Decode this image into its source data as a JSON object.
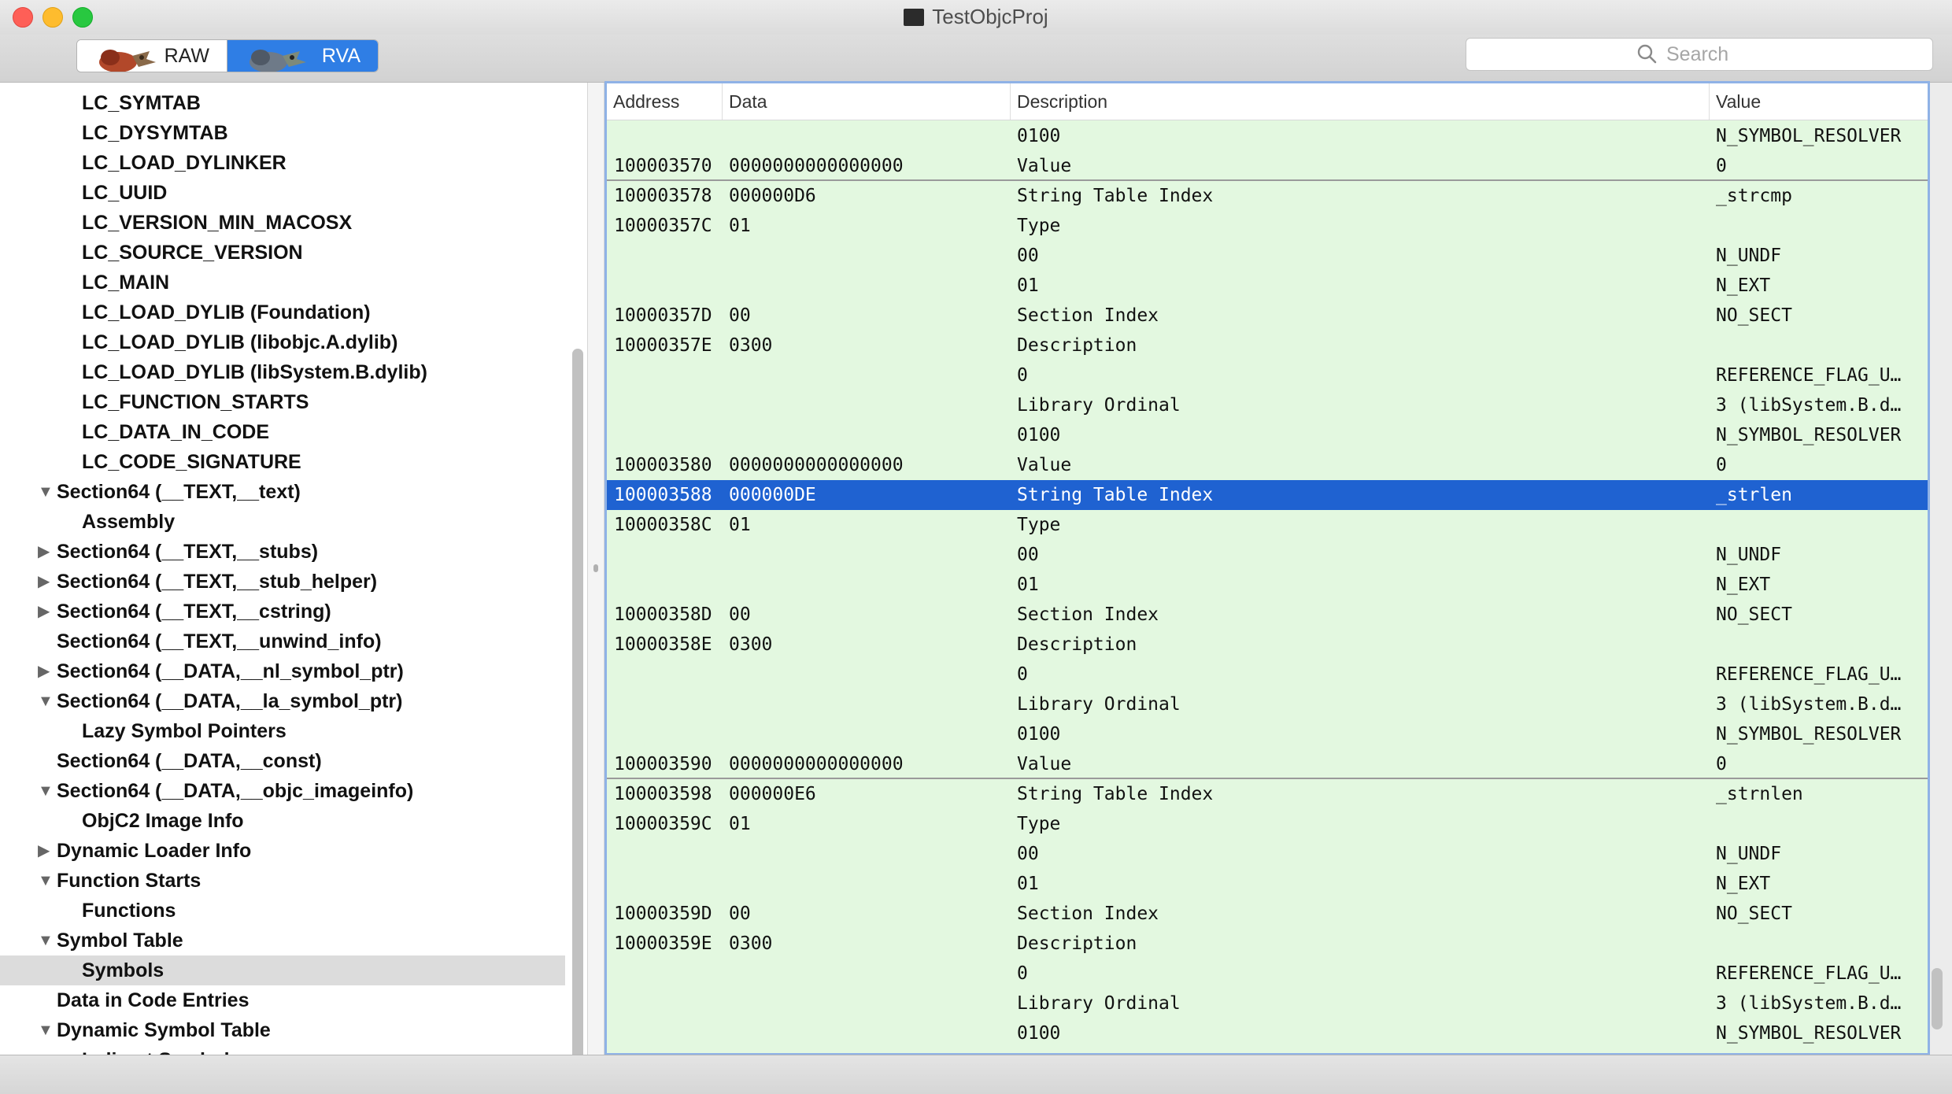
{
  "window": {
    "title": "TestObjcProj"
  },
  "toolbar": {
    "raw_label": "RAW",
    "rva_label": "RVA",
    "search_placeholder": "Search"
  },
  "colors": {
    "selection": "#1f62d1",
    "table_bg": "#e3f8e0",
    "accent": "#2f7ee5"
  },
  "tree": [
    {
      "label": "LC_SYMTAB",
      "indent": 1
    },
    {
      "label": "LC_DYSYMTAB",
      "indent": 1
    },
    {
      "label": "LC_LOAD_DYLINKER",
      "indent": 1
    },
    {
      "label": "LC_UUID",
      "indent": 1
    },
    {
      "label": "LC_VERSION_MIN_MACOSX",
      "indent": 1
    },
    {
      "label": "LC_SOURCE_VERSION",
      "indent": 1
    },
    {
      "label": "LC_MAIN",
      "indent": 1
    },
    {
      "label": "LC_LOAD_DYLIB (Foundation)",
      "indent": 1
    },
    {
      "label": "LC_LOAD_DYLIB (libobjc.A.dylib)",
      "indent": 1
    },
    {
      "label": "LC_LOAD_DYLIB (libSystem.B.dylib)",
      "indent": 1
    },
    {
      "label": "LC_FUNCTION_STARTS",
      "indent": 1
    },
    {
      "label": "LC_DATA_IN_CODE",
      "indent": 1
    },
    {
      "label": "LC_CODE_SIGNATURE",
      "indent": 1
    },
    {
      "label": "Section64 (__TEXT,__text)",
      "indent": 0,
      "disclosure": "expanded"
    },
    {
      "label": "Assembly",
      "indent": 1
    },
    {
      "label": "Section64 (__TEXT,__stubs)",
      "indent": 0,
      "disclosure": "collapsed"
    },
    {
      "label": "Section64 (__TEXT,__stub_helper)",
      "indent": 0,
      "disclosure": "collapsed"
    },
    {
      "label": "Section64 (__TEXT,__cstring)",
      "indent": 0,
      "disclosure": "collapsed"
    },
    {
      "label": "Section64 (__TEXT,__unwind_info)",
      "indent": 0
    },
    {
      "label": "Section64 (__DATA,__nl_symbol_ptr)",
      "indent": 0,
      "disclosure": "collapsed"
    },
    {
      "label": "Section64 (__DATA,__la_symbol_ptr)",
      "indent": 0,
      "disclosure": "expanded"
    },
    {
      "label": "Lazy Symbol Pointers",
      "indent": 1
    },
    {
      "label": "Section64 (__DATA,__const)",
      "indent": 0
    },
    {
      "label": "Section64 (__DATA,__objc_imageinfo)",
      "indent": 0,
      "disclosure": "expanded"
    },
    {
      "label": "ObjC2 Image Info",
      "indent": 1
    },
    {
      "label": "Dynamic Loader Info",
      "indent": 0,
      "disclosure": "collapsed"
    },
    {
      "label": "Function Starts",
      "indent": 0,
      "disclosure": "expanded"
    },
    {
      "label": "Functions",
      "indent": 1
    },
    {
      "label": "Symbol Table",
      "indent": 0,
      "disclosure": "expanded"
    },
    {
      "label": "Symbols",
      "indent": 1,
      "selected": true
    },
    {
      "label": "Data in Code Entries",
      "indent": 0
    },
    {
      "label": "Dynamic Symbol Table",
      "indent": 0,
      "disclosure": "expanded"
    },
    {
      "label": "Indirect Symbols",
      "indent": 1
    }
  ],
  "table": {
    "columns": [
      "Address",
      "Data",
      "Description",
      "Value"
    ],
    "rows": [
      [
        "",
        "",
        "0100",
        "N_SYMBOL_RESOLVER"
      ],
      [
        "100003570",
        "0000000000000000",
        "Value",
        "0"
      ],
      [
        "100003578",
        "000000D6",
        "String Table Index",
        "_strcmp"
      ],
      [
        "10000357C",
        "01",
        "Type",
        ""
      ],
      [
        "",
        "",
        "00",
        "N_UNDF"
      ],
      [
        "",
        "",
        "01",
        "N_EXT"
      ],
      [
        "10000357D",
        "00",
        "Section Index",
        "NO_SECT"
      ],
      [
        "10000357E",
        "0300",
        "Description",
        ""
      ],
      [
        "",
        "",
        "0",
        "REFERENCE_FLAG_U…"
      ],
      [
        "",
        "",
        "Library Ordinal",
        "3 (libSystem.B.d…"
      ],
      [
        "",
        "",
        "0100",
        "N_SYMBOL_RESOLVER"
      ],
      [
        "100003580",
        "0000000000000000",
        "Value",
        "0"
      ],
      [
        "100003588",
        "000000DE",
        "String Table Index",
        "_strlen"
      ],
      [
        "10000358C",
        "01",
        "Type",
        ""
      ],
      [
        "",
        "",
        "00",
        "N_UNDF"
      ],
      [
        "",
        "",
        "01",
        "N_EXT"
      ],
      [
        "10000358D",
        "00",
        "Section Index",
        "NO_SECT"
      ],
      [
        "10000358E",
        "0300",
        "Description",
        ""
      ],
      [
        "",
        "",
        "0",
        "REFERENCE_FLAG_U…"
      ],
      [
        "",
        "",
        "Library Ordinal",
        "3 (libSystem.B.d…"
      ],
      [
        "",
        "",
        "0100",
        "N_SYMBOL_RESOLVER"
      ],
      [
        "100003590",
        "0000000000000000",
        "Value",
        "0"
      ],
      [
        "100003598",
        "000000E6",
        "String Table Index",
        "_strnlen"
      ],
      [
        "10000359C",
        "01",
        "Type",
        ""
      ],
      [
        "",
        "",
        "00",
        "N_UNDF"
      ],
      [
        "",
        "",
        "01",
        "N_EXT"
      ],
      [
        "10000359D",
        "00",
        "Section Index",
        "NO_SECT"
      ],
      [
        "10000359E",
        "0300",
        "Description",
        ""
      ],
      [
        "",
        "",
        "0",
        "REFERENCE_FLAG_U…"
      ],
      [
        "",
        "",
        "Library Ordinal",
        "3 (libSystem.B.d…"
      ],
      [
        "",
        "",
        "0100",
        "N_SYMBOL_RESOLVER"
      ]
    ],
    "selected_row": 12,
    "separator_rows": [
      1,
      21
    ]
  }
}
